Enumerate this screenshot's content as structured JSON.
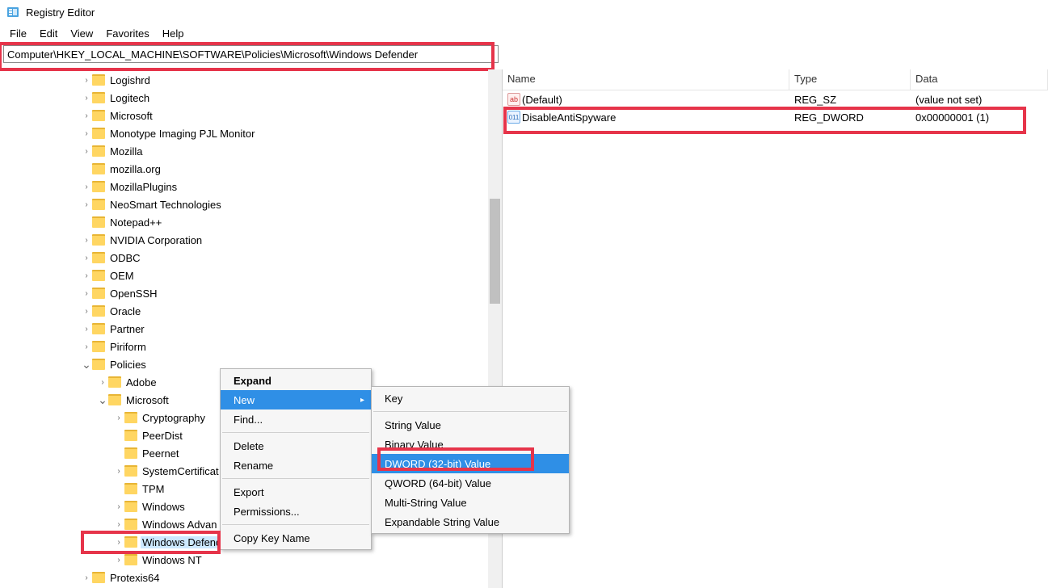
{
  "window_title": "Registry Editor",
  "menus": [
    "File",
    "Edit",
    "View",
    "Favorites",
    "Help"
  ],
  "address": "Computer\\HKEY_LOCAL_MACHINE\\SOFTWARE\\Policies\\Microsoft\\Windows Defender",
  "tree": [
    {
      "indent": 3,
      "exp": ">",
      "label": "Logishrd"
    },
    {
      "indent": 3,
      "exp": ">",
      "label": "Logitech"
    },
    {
      "indent": 3,
      "exp": ">",
      "label": "Microsoft"
    },
    {
      "indent": 3,
      "exp": ">",
      "label": "Monotype Imaging PJL Monitor"
    },
    {
      "indent": 3,
      "exp": ">",
      "label": "Mozilla"
    },
    {
      "indent": 3,
      "exp": "",
      "label": "mozilla.org"
    },
    {
      "indent": 3,
      "exp": ">",
      "label": "MozillaPlugins"
    },
    {
      "indent": 3,
      "exp": ">",
      "label": "NeoSmart Technologies"
    },
    {
      "indent": 3,
      "exp": "",
      "label": "Notepad++"
    },
    {
      "indent": 3,
      "exp": ">",
      "label": "NVIDIA Corporation"
    },
    {
      "indent": 3,
      "exp": ">",
      "label": "ODBC"
    },
    {
      "indent": 3,
      "exp": ">",
      "label": "OEM"
    },
    {
      "indent": 3,
      "exp": ">",
      "label": "OpenSSH"
    },
    {
      "indent": 3,
      "exp": ">",
      "label": "Oracle"
    },
    {
      "indent": 3,
      "exp": ">",
      "label": "Partner"
    },
    {
      "indent": 3,
      "exp": ">",
      "label": "Piriform"
    },
    {
      "indent": 3,
      "exp": "v",
      "label": "Policies"
    },
    {
      "indent": 4,
      "exp": ">",
      "label": "Adobe"
    },
    {
      "indent": 4,
      "exp": "v",
      "label": "Microsoft"
    },
    {
      "indent": 5,
      "exp": ">",
      "label": "Cryptography"
    },
    {
      "indent": 5,
      "exp": "",
      "label": "PeerDist"
    },
    {
      "indent": 5,
      "exp": "",
      "label": "Peernet"
    },
    {
      "indent": 5,
      "exp": ">",
      "label": "SystemCertificat"
    },
    {
      "indent": 5,
      "exp": "",
      "label": "TPM"
    },
    {
      "indent": 5,
      "exp": ">",
      "label": "Windows"
    },
    {
      "indent": 5,
      "exp": ">",
      "label": "Windows Advan"
    },
    {
      "indent": 5,
      "exp": ">",
      "label": "Windows Defende",
      "sel": true
    },
    {
      "indent": 5,
      "exp": ">",
      "label": "Windows NT"
    },
    {
      "indent": 3,
      "exp": ">",
      "label": "Protexis64"
    }
  ],
  "list_headers": {
    "name": "Name",
    "type": "Type",
    "data": "Data"
  },
  "list_rows": [
    {
      "icon": "sz",
      "name": "(Default)",
      "type": "REG_SZ",
      "data": "(value not set)"
    },
    {
      "icon": "dw",
      "name": "DisableAntiSpyware",
      "type": "REG_DWORD",
      "data": "0x00000001 (1)"
    }
  ],
  "context_menu": [
    {
      "label": "Expand",
      "bold": true
    },
    {
      "label": "New",
      "hover": true,
      "arrow": true
    },
    {
      "label": "Find..."
    },
    {
      "sep": true
    },
    {
      "label": "Delete"
    },
    {
      "label": "Rename"
    },
    {
      "sep": true
    },
    {
      "label": "Export"
    },
    {
      "label": "Permissions..."
    },
    {
      "sep": true
    },
    {
      "label": "Copy Key Name"
    }
  ],
  "submenu": [
    {
      "label": "Key"
    },
    {
      "sep": true
    },
    {
      "label": "String Value"
    },
    {
      "label": "Binary Value"
    },
    {
      "label": "DWORD (32-bit) Value",
      "hover": true
    },
    {
      "label": "QWORD (64-bit) Value"
    },
    {
      "label": "Multi-String Value"
    },
    {
      "label": "Expandable String Value"
    }
  ]
}
